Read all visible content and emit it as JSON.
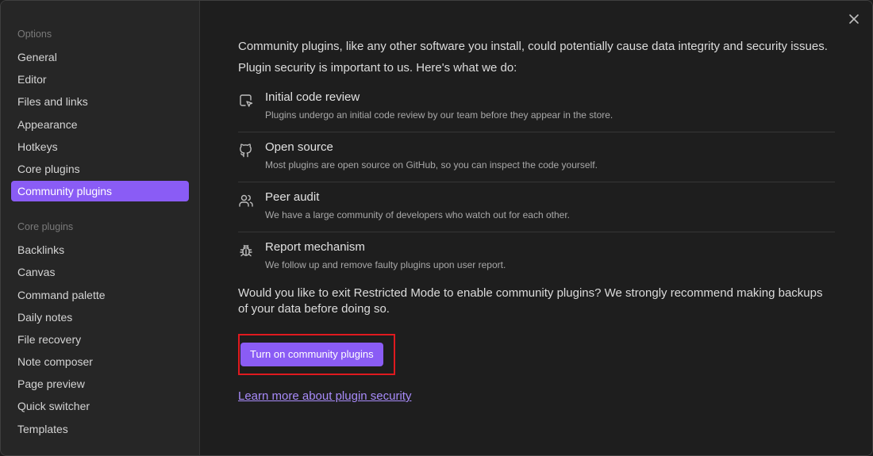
{
  "sidebar": {
    "options_heading": "Options",
    "options_items": [
      {
        "label": "General"
      },
      {
        "label": "Editor"
      },
      {
        "label": "Files and links"
      },
      {
        "label": "Appearance"
      },
      {
        "label": "Hotkeys"
      },
      {
        "label": "Core plugins"
      },
      {
        "label": "Community plugins",
        "active": true
      }
    ],
    "core_heading": "Core plugins",
    "core_items": [
      {
        "label": "Backlinks"
      },
      {
        "label": "Canvas"
      },
      {
        "label": "Command palette"
      },
      {
        "label": "Daily notes"
      },
      {
        "label": "File recovery"
      },
      {
        "label": "Note composer"
      },
      {
        "label": "Page preview"
      },
      {
        "label": "Quick switcher"
      },
      {
        "label": "Templates"
      }
    ]
  },
  "main": {
    "intro": "Community plugins, like any other software you install, could potentially cause data integrity and security issues.",
    "lead": "Plugin security is important to us. Here's what we do:",
    "features": [
      {
        "icon": "cursor-click-icon",
        "title": "Initial code review",
        "desc": "Plugins undergo an initial code review by our team before they appear in the store."
      },
      {
        "icon": "github-icon",
        "title": "Open source",
        "desc": "Most plugins are open source on GitHub, so you can inspect the code yourself."
      },
      {
        "icon": "users-icon",
        "title": "Peer audit",
        "desc": "We have a large community of developers who watch out for each other."
      },
      {
        "icon": "bug-icon",
        "title": "Report mechanism",
        "desc": "We follow up and remove faulty plugins upon user report."
      }
    ],
    "question": "Would you like to exit Restricted Mode to enable community plugins? We strongly recommend making backups of your data before doing so.",
    "turn_on_label": "Turn on community plugins",
    "learn_more_label": "Learn more about plugin security"
  },
  "colors": {
    "accent": "#8a5cf5",
    "link": "#a88bfa",
    "highlight_box": "#e0191f"
  }
}
